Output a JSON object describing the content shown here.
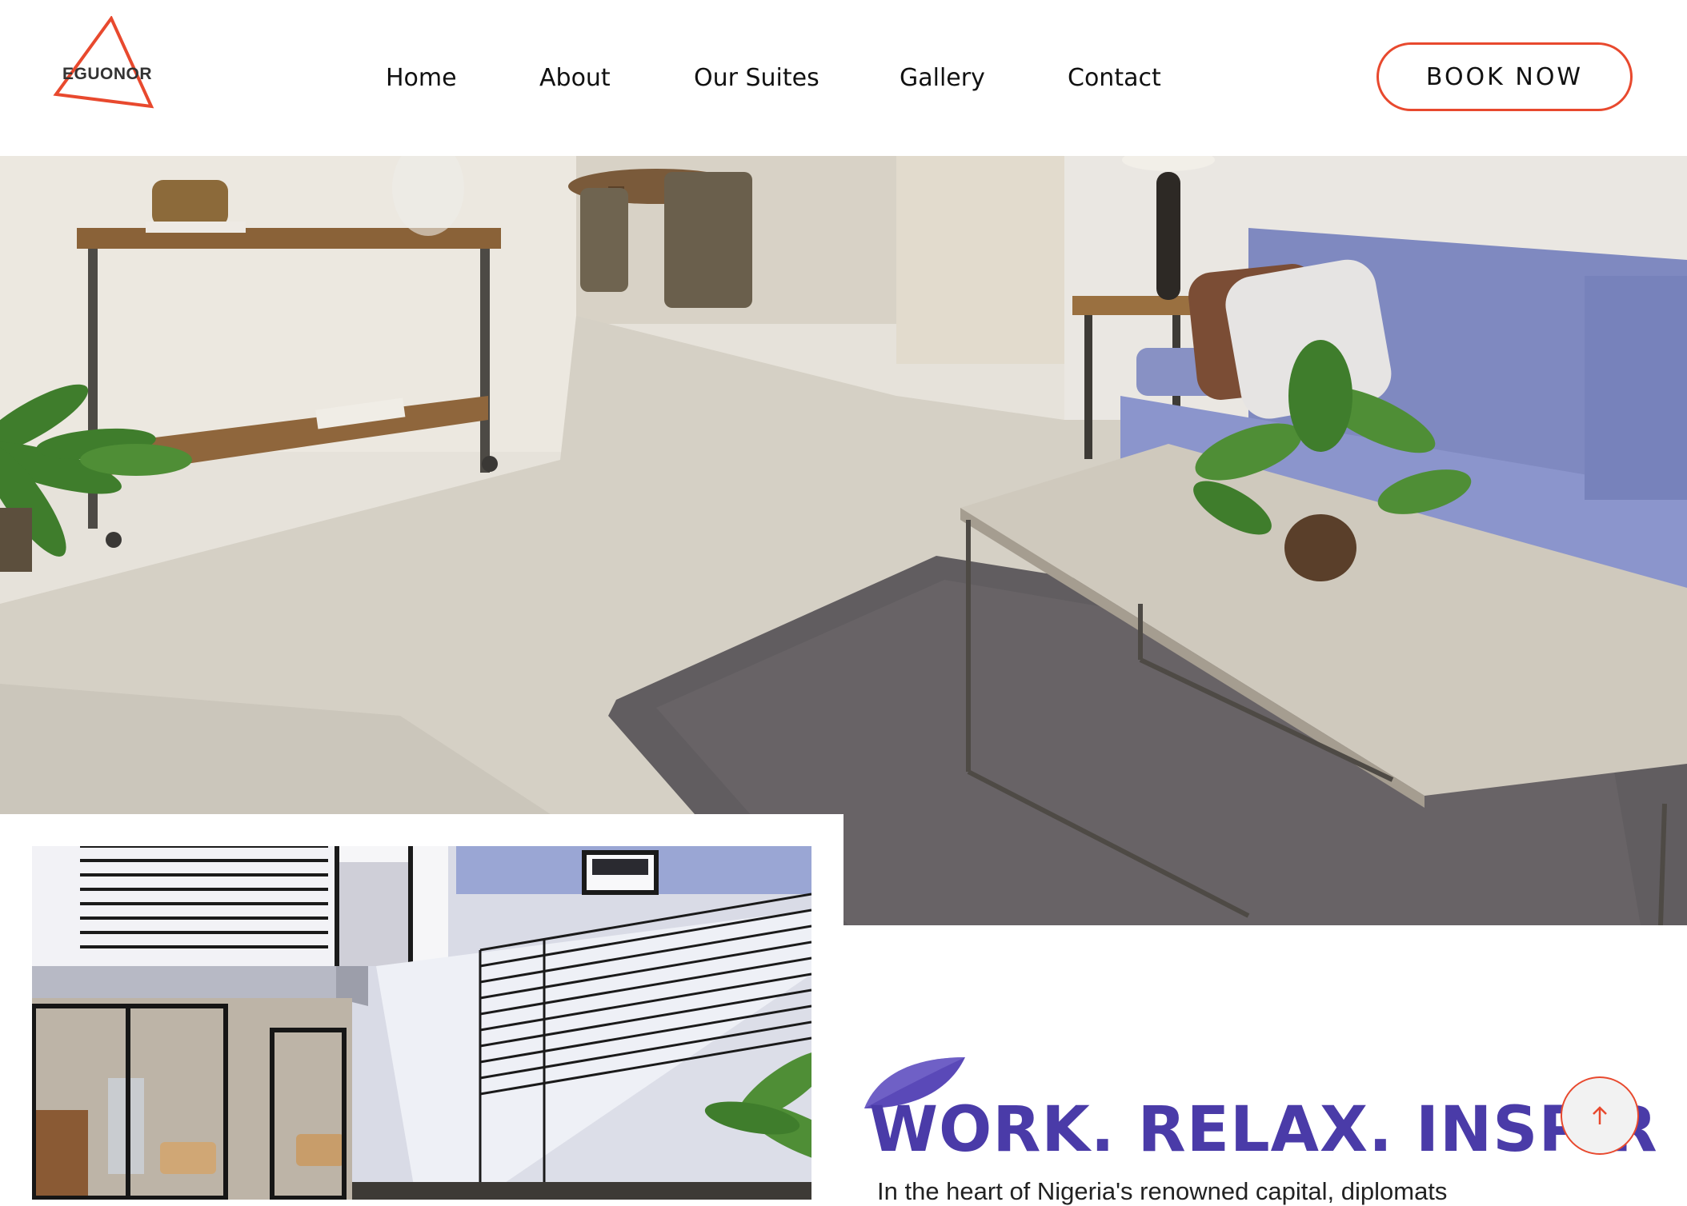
{
  "brand": {
    "name": "EGUONOR",
    "accent_color": "#e8492e",
    "headline_color": "#4a3ba8"
  },
  "nav": {
    "items": [
      {
        "label": "Home"
      },
      {
        "label": "About"
      },
      {
        "label": "Our Suites"
      },
      {
        "label": "Gallery"
      },
      {
        "label": "Contact"
      }
    ],
    "cta_label": "BOOK NOW"
  },
  "hero": {
    "image": "living-room-photo"
  },
  "feature": {
    "image": "modern-house-courtyard-photo",
    "headline": "WORK. RELAX. INSPIR",
    "intro": "In the heart of Nigeria's renowned capital, diplomats"
  },
  "icons": {
    "scroll_top": "arrow-up-icon",
    "logo_shape": "triangle-icon"
  }
}
